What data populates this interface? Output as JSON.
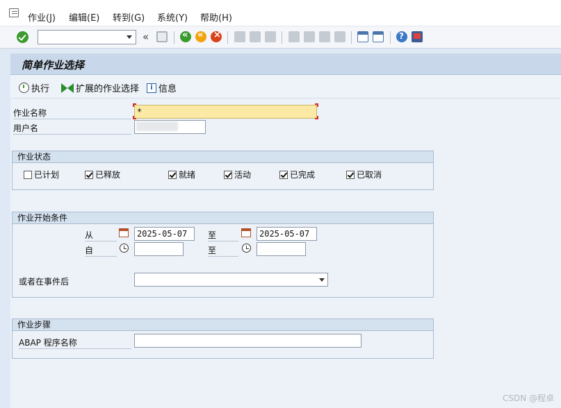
{
  "menu": {
    "items": [
      "作业(J)",
      "编辑(E)",
      "转到(G)",
      "系统(Y)",
      "帮助(H)"
    ]
  },
  "toolbar": {
    "command_value": "",
    "double_arrow": "«"
  },
  "screen": {
    "title": "简单作业选择"
  },
  "app_toolbar": {
    "execute": "执行",
    "extended": "扩展的作业选择",
    "info": "信息"
  },
  "fields": {
    "job_name_label": "作业名称",
    "job_name_value": "*",
    "user_name_label": "用户名"
  },
  "job_status": {
    "title": "作业状态",
    "options": [
      {
        "label": "已计划",
        "checked": false
      },
      {
        "label": "已释放",
        "checked": true
      },
      {
        "label": "就绪",
        "checked": true
      },
      {
        "label": "活动",
        "checked": true
      },
      {
        "label": "已完成",
        "checked": true
      },
      {
        "label": "已取消",
        "checked": true
      }
    ]
  },
  "start_conditions": {
    "title": "作业开始条件",
    "from_label": "从",
    "from_date": "2025-05-07",
    "to_label": "至",
    "to_date": "2025-05-07",
    "time_from_label": "自",
    "time_from": "",
    "time_to_label": "至",
    "time_to": "",
    "event_label": "或者在事件后",
    "event_value": ""
  },
  "job_steps": {
    "title": "作业步骤",
    "program_label": "ABAP 程序名称",
    "program_value": ""
  },
  "watermark": "CSDN @程卓"
}
